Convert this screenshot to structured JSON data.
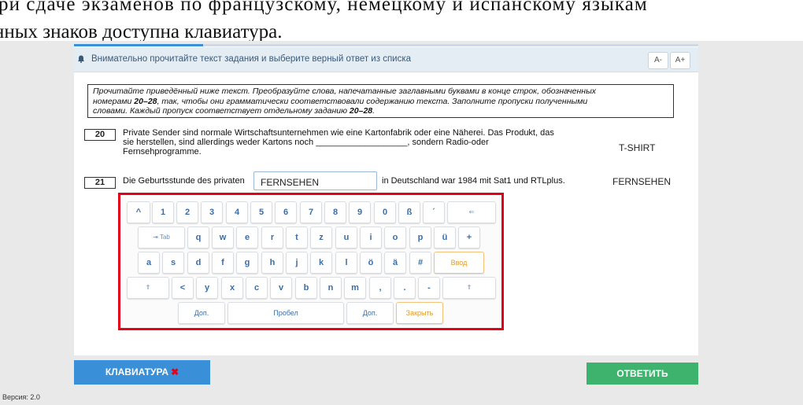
{
  "doc": {
    "line1": "ри сдаче экзаменов по французскому, немецкому и испанскому языкам",
    "line2": "нных знаков доступна клавиатура."
  },
  "instruction": {
    "icon": "bell-icon",
    "text": "Внимательно прочитайте текст задания и выберите верный ответ из списка",
    "font_minus": "A-",
    "font_plus": "A+"
  },
  "task": {
    "line1": "Прочитайте приведённый ниже текст. Преобразуйте слова, напечатанные заглавными буквами в конце строк, обозначенных",
    "line2_a": "номерами ",
    "line2_b": "20–28",
    "line2_c": ", так, чтобы они грамматически соответствовали содержанию текста. Заполните пропуски полученными",
    "line3_a": "словами. Каждый пропуск соответствует отдельному заданию ",
    "line3_b": "20–28",
    "line3_c": "."
  },
  "questions": [
    {
      "number": "20",
      "line1": "Private Sender sind normale Wirtschaftsunternehmen wie eine Kartonfabrik oder eine Näherei. Das Produkt, das",
      "line2": "sie herstellen, sind allerdings weder Kartons noch ___________________, sondern Radio-oder",
      "line3": "Fernsehprogramme.",
      "answer_word": "T-SHIRT"
    },
    {
      "number": "21",
      "text_before": "Die Geburtsstunde des privaten",
      "input_value": "FERNSEHEN",
      "text_after": "in Deutschland war 1984 mit Sat1 und RTLplus.",
      "answer_word": "FERNSEHEN"
    }
  ],
  "keyboard": {
    "row1": [
      "^",
      "1",
      "2",
      "3",
      "4",
      "5",
      "6",
      "7",
      "8",
      "9",
      "0",
      "ß",
      "´",
      "⇐"
    ],
    "row2": [
      "⇥ Tab",
      "q",
      "w",
      "e",
      "r",
      "t",
      "z",
      "u",
      "i",
      "o",
      "p",
      "ü",
      "+"
    ],
    "row3": [
      "a",
      "s",
      "d",
      "f",
      "g",
      "h",
      "j",
      "k",
      "l",
      "ö",
      "ä",
      "#",
      "Ввод"
    ],
    "row4": [
      "⇑",
      "<",
      "y",
      "x",
      "c",
      "v",
      "b",
      "n",
      "m",
      ",",
      ".",
      "-",
      "⇑"
    ],
    "row5": [
      "Доп.",
      "Пробел",
      "Доп.",
      "Закрыть"
    ]
  },
  "buttons": {
    "keyboard_label": "КЛАВИАТУРА",
    "keyboard_x": "✖",
    "answer_label": "ОТВЕТИТЬ"
  },
  "version": "Версия: 2.0",
  "colors": {
    "primary": "#3a8fd9",
    "success": "#3db36d",
    "highlight_frame": "#e2001a",
    "key_text": "#3b6ea8",
    "key_accent": "#e69a1f"
  }
}
